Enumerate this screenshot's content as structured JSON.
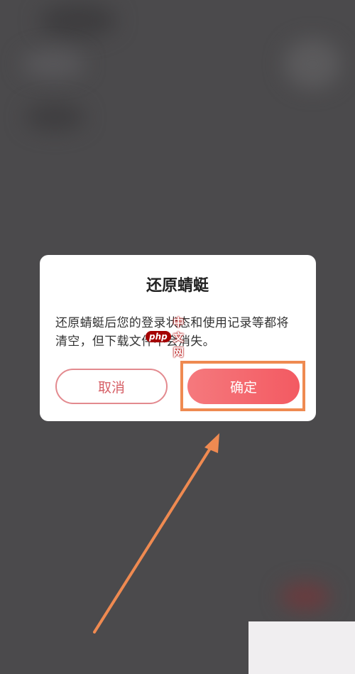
{
  "dialog": {
    "title": "还原蜻蜓",
    "message": "还原蜻蜓后您的登录状态和使用记录等都将清空，但下载文件不会消失。",
    "cancel_label": "取消",
    "confirm_label": "确定"
  },
  "watermark": {
    "badge": "php",
    "text": "中文网"
  },
  "colors": {
    "background": "#4b4a4c",
    "accent": "#f35a62",
    "highlight": "#ef8a51"
  }
}
